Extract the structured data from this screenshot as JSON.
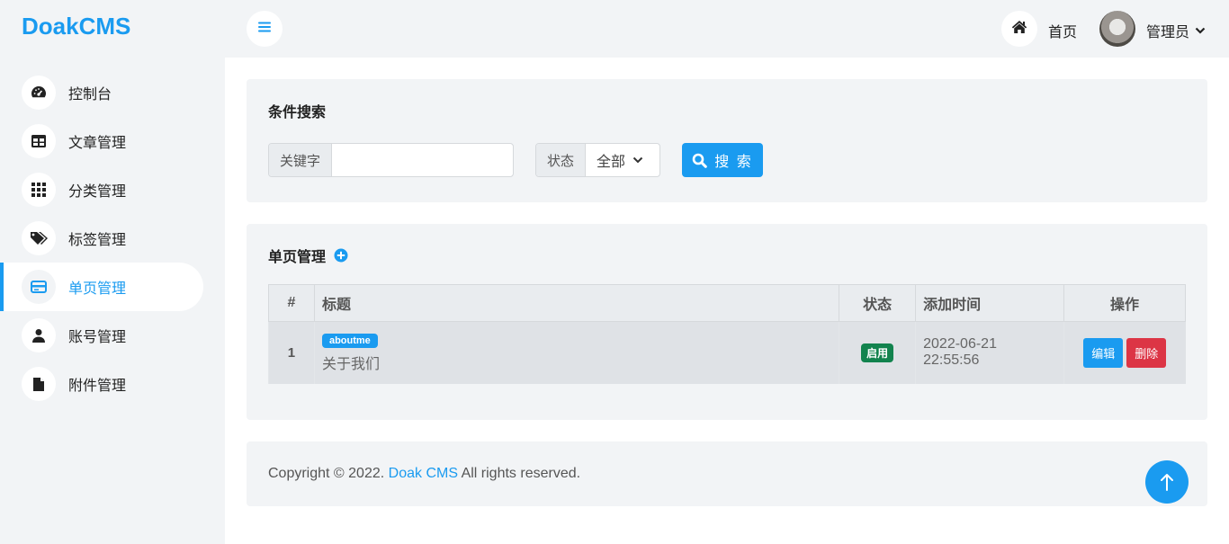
{
  "brand": "DoakCMS",
  "sidebar": {
    "items": [
      {
        "label": "控制台",
        "icon": "dashboard-icon"
      },
      {
        "label": "文章管理",
        "icon": "table-icon"
      },
      {
        "label": "分类管理",
        "icon": "grid-icon"
      },
      {
        "label": "标签管理",
        "icon": "tags-icon"
      },
      {
        "label": "单页管理",
        "icon": "page-card-icon",
        "active": true
      },
      {
        "label": "账号管理",
        "icon": "user-icon"
      },
      {
        "label": "附件管理",
        "icon": "file-icon"
      }
    ]
  },
  "topbar": {
    "home_label": "首页",
    "user_label": "管理员"
  },
  "search": {
    "title": "条件搜索",
    "keyword_label": "关键字",
    "keyword_value": "",
    "status_label": "状态",
    "status_value": "全部",
    "button_label": "搜 索"
  },
  "list": {
    "title": "单页管理",
    "columns": [
      "#",
      "标题",
      "状态",
      "添加时间",
      "操作"
    ],
    "rows": [
      {
        "id": "1",
        "slug": "aboutme",
        "title": "关于我们",
        "status": "启用",
        "added": "2022-06-21 22:55:56",
        "edit_label": "编辑",
        "delete_label": "删除"
      }
    ]
  },
  "footer": {
    "prefix": "Copyright © 2022. ",
    "link": "Doak CMS",
    "suffix": " All rights reserved."
  },
  "colors": {
    "accent": "#1a9bf0",
    "success": "#12834e",
    "danger": "#dc3545"
  }
}
